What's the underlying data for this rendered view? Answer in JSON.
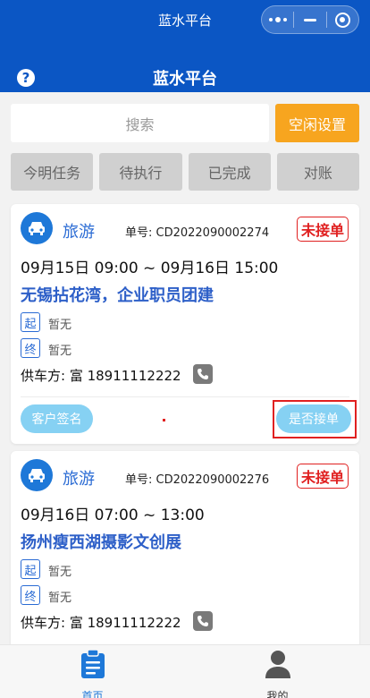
{
  "statusbar": {
    "title": "蓝水平台"
  },
  "header": {
    "title": "蓝水平台",
    "help_icon": "question-circle-icon"
  },
  "search": {
    "placeholder": "搜索"
  },
  "idle_settings_label": "空闲设置",
  "tabs": [
    {
      "label": "今明任务"
    },
    {
      "label": "待执行"
    },
    {
      "label": "已完成"
    },
    {
      "label": "对账"
    }
  ],
  "orders": [
    {
      "type": "旅游",
      "order_no": "单号: CD2022090002274",
      "status": "未接单",
      "time_range": "09月15日 09:00 ~ 09月16日 15:00",
      "title": "无锡拈花湾，企业职员团建",
      "start_tag": "起",
      "start_value": "暂无",
      "end_tag": "终",
      "end_value": "暂无",
      "supplier": "供车方: 富  18911112222",
      "sign_label": "客户签名",
      "accept_label": "是否接单"
    },
    {
      "type": "旅游",
      "order_no": "单号: CD2022090002276",
      "status": "未接单",
      "time_range": "09月16日 07:00 ~ 13:00",
      "title": "扬州瘦西湖摄影文创展",
      "start_tag": "起",
      "start_value": "暂无",
      "end_tag": "终",
      "end_value": "暂无",
      "supplier": "供车方: 富  18911112222"
    }
  ],
  "bottom_nav": [
    {
      "label": "首页",
      "icon": "clipboard-icon",
      "active": true
    },
    {
      "label": "我的",
      "icon": "user-icon",
      "active": false
    }
  ],
  "colors": {
    "brand_blue": "#0b56c4",
    "accent_orange": "#f7a51f",
    "status_red": "#e02020",
    "button_light_blue": "#86d1f3"
  }
}
